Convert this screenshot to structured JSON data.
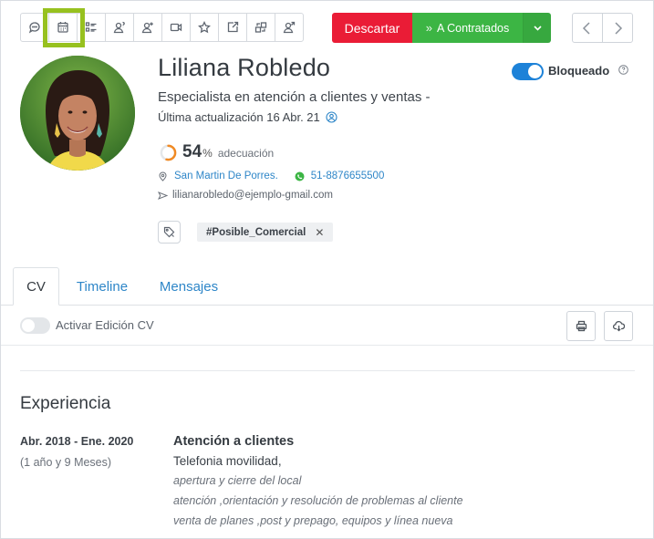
{
  "toolbar": {
    "icons": [
      "chat-icon",
      "calendar-icon",
      "checklist-icon",
      "user-question-icon",
      "user-add-icon",
      "video-icon",
      "star-icon",
      "share-icon",
      "transfer-icon",
      "user-send-icon"
    ],
    "highlight_color": "#97c11f"
  },
  "actions": {
    "discard_label": "Descartar",
    "hire_label": "A Contratados",
    "discard_color": "#ea1c36",
    "hire_color": "#3cb544"
  },
  "profile": {
    "name": "Liliana Robledo",
    "role": "Especialista en atención a clientes y ventas -",
    "updated": "Última actualización 16 Abr. 21",
    "blocked_label": "Bloqueado",
    "blocked_on": true,
    "match_value": "54",
    "match_fraction": 0.54,
    "match_symbol": "%",
    "match_label": "adecuación",
    "location": "San Martin De Porres.",
    "phone": "51-8876655500",
    "email": "lilianarobledo@ejemplo-gmail.com",
    "tag": "#Posible_Comercial",
    "tag_remove": "✕"
  },
  "tabs": [
    {
      "label": "CV",
      "active": true
    },
    {
      "label": "Timeline",
      "active": false
    },
    {
      "label": "Mensajes",
      "active": false
    }
  ],
  "cv": {
    "edit_label": "Activar Edición CV",
    "edit_on": false,
    "section_title": "Experiencia",
    "experience": {
      "date_range": "Abr. 2018 - Ene. 2020",
      "duration": "(1 año y 9 Meses)",
      "title": "Atención a clientes",
      "company": "Telefonia movilidad,",
      "lines": [
        "apertura y cierre del local",
        "atención ,orientación y resolución de problemas al cliente",
        "venta de planes ,post y prepago, equipos y línea nueva"
      ]
    }
  }
}
